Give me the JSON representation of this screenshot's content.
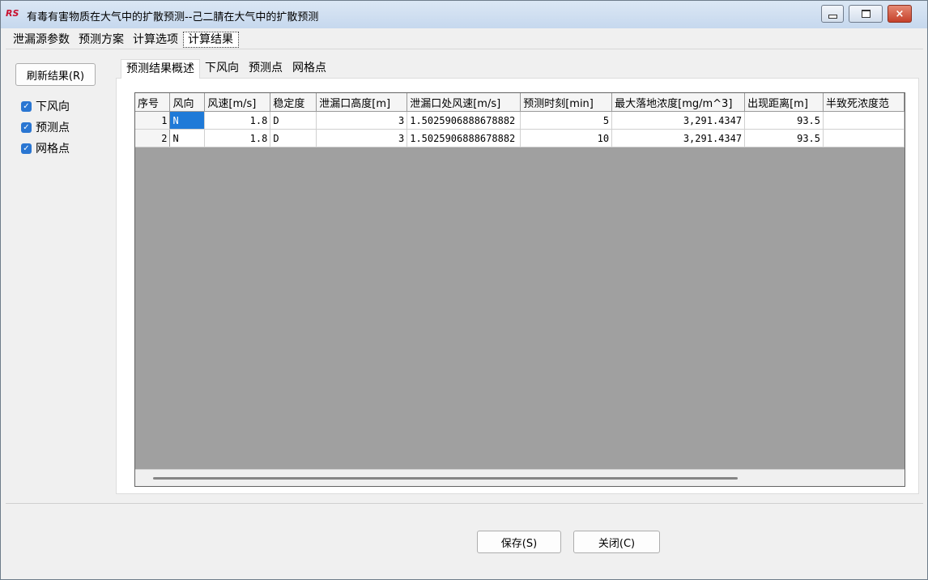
{
  "window": {
    "title": "有毒有害物质在大气中的扩散预测--己二腈在大气中的扩散预测",
    "app_icon_text": "RS",
    "controls": {
      "minimize": "minimize",
      "maximize": "maximize",
      "close": "×"
    }
  },
  "main_tabs": [
    {
      "label": "泄漏源参数",
      "active": false
    },
    {
      "label": "预测方案",
      "active": false
    },
    {
      "label": "计算选项",
      "active": false
    },
    {
      "label": "计算结果",
      "active": true
    }
  ],
  "left_panel": {
    "refresh_label": "刷新结果(R)",
    "checkboxes": [
      {
        "label": "下风向",
        "checked": true
      },
      {
        "label": "预测点",
        "checked": true
      },
      {
        "label": "网格点",
        "checked": true
      }
    ]
  },
  "sub_tabs": [
    {
      "label": "预测结果概述",
      "active": true
    },
    {
      "label": "下风向",
      "active": false
    },
    {
      "label": "预测点",
      "active": false
    },
    {
      "label": "网格点",
      "active": false
    }
  ],
  "table": {
    "headers": [
      "序号",
      "风向",
      "风速[m/s]",
      "稳定度",
      "泄漏口高度[m]",
      "泄漏口处风速[m/s]",
      "预测时刻[min]",
      "最大落地浓度[mg/m^3]",
      "出现距离[m]",
      "半致死浓度范"
    ],
    "rows": [
      [
        "1",
        "N",
        "1.8",
        "D",
        "3",
        "1.5025906888678882",
        "5",
        "3,291.4347",
        "93.5",
        ""
      ],
      [
        "2",
        "N",
        "1.8",
        "D",
        "3",
        "1.5025906888678882",
        "10",
        "3,291.4347",
        "93.5",
        ""
      ]
    ]
  },
  "footer": {
    "save_label": "保存(S)",
    "close_label": "关闭(C)"
  },
  "colors": {
    "selection": "#1f7ad8",
    "check": "#2a76d2",
    "grid_empty": "#a0a0a0"
  }
}
